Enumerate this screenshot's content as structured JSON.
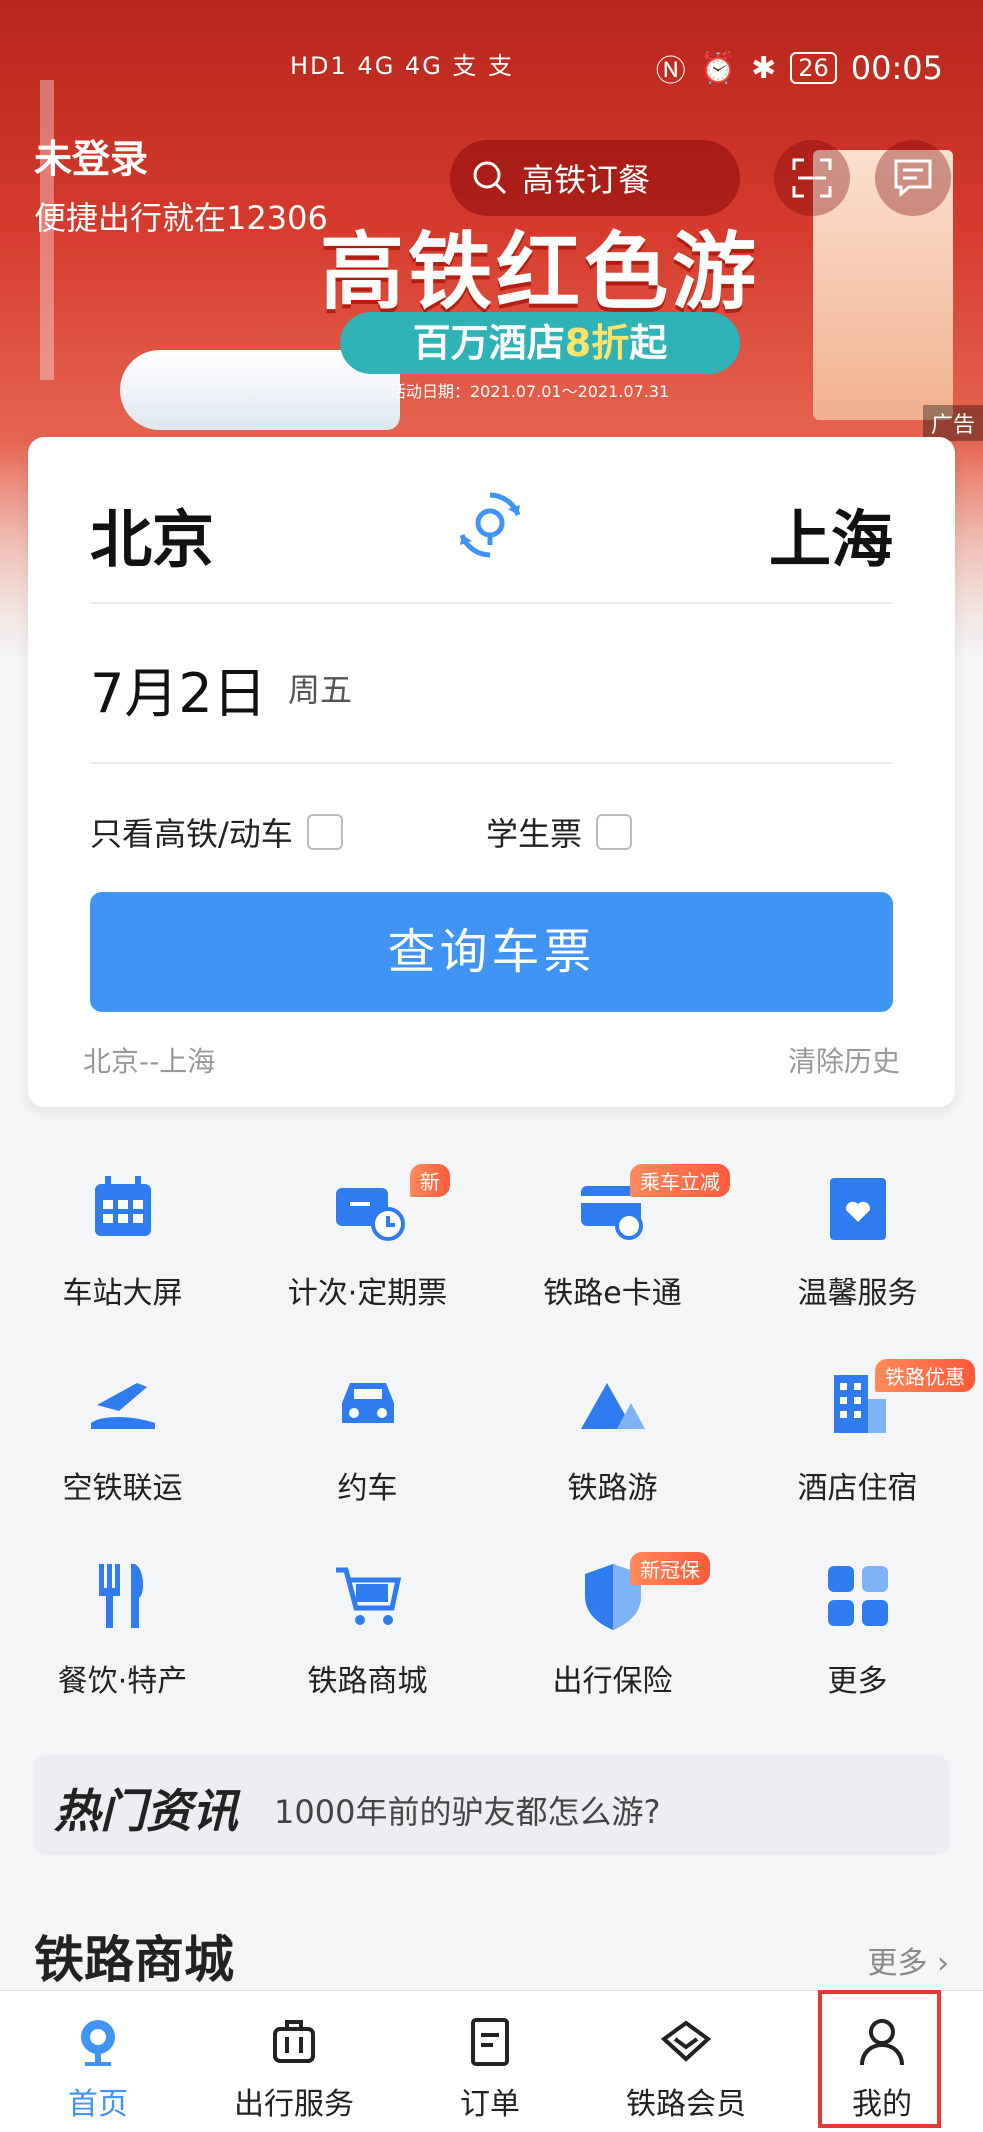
{
  "status_bar": {
    "left": "HD1 4G 4G 支 支",
    "battery": "26",
    "time": "00:05"
  },
  "header": {
    "login_title": "未登录",
    "login_sub": "便捷出行就在12306",
    "search_text": "高铁订餐"
  },
  "banner": {
    "title": "高铁红色游",
    "sub_a": "百万酒店",
    "sub_b": "8折",
    "sub_c": "起",
    "date": "活动日期：2021.07.01～2021.07.31",
    "ad_tag": "广告"
  },
  "ticket_form": {
    "from": "北京",
    "to": "上海",
    "date": "7月2日",
    "weekday": "周五",
    "opt_highspeed": "只看高铁/动车",
    "opt_student": "学生票",
    "query_button": "查询车票",
    "history": "北京--上海",
    "clear_history": "清除历史"
  },
  "services": [
    {
      "label": "车站大屏",
      "icon": "calendar-icon",
      "badge": ""
    },
    {
      "label": "计次·定期票",
      "icon": "ticket-clock-icon",
      "badge": "新"
    },
    {
      "label": "铁路e卡通",
      "icon": "card-icon",
      "badge": "乘车立减"
    },
    {
      "label": "温馨服务",
      "icon": "heart-box-icon",
      "badge": ""
    },
    {
      "label": "空铁联运",
      "icon": "plane-train-icon",
      "badge": ""
    },
    {
      "label": "约车",
      "icon": "car-icon",
      "badge": ""
    },
    {
      "label": "铁路游",
      "icon": "mountain-icon",
      "badge": ""
    },
    {
      "label": "酒店住宿",
      "icon": "hotel-icon",
      "badge": "铁路优惠"
    },
    {
      "label": "餐饮·特产",
      "icon": "fork-knife-icon",
      "badge": ""
    },
    {
      "label": "铁路商城",
      "icon": "cart-icon",
      "badge": ""
    },
    {
      "label": "出行保险",
      "icon": "shield-icon",
      "badge": "新冠保"
    },
    {
      "label": "更多",
      "icon": "grid-icon",
      "badge": ""
    }
  ],
  "news": {
    "tag": "热门资讯",
    "text": "1000年前的驴友都怎么游?"
  },
  "mall": {
    "title": "铁路商城",
    "more": "更多"
  },
  "tabs": [
    {
      "label": "首页",
      "active": true
    },
    {
      "label": "出行服务",
      "active": false
    },
    {
      "label": "订单",
      "active": false
    },
    {
      "label": "铁路会员",
      "active": false
    },
    {
      "label": "我的",
      "active": false
    }
  ],
  "colors": {
    "accent": "#3f94f5",
    "banner_red": "#d63b2e",
    "highlight": "#e53935"
  }
}
